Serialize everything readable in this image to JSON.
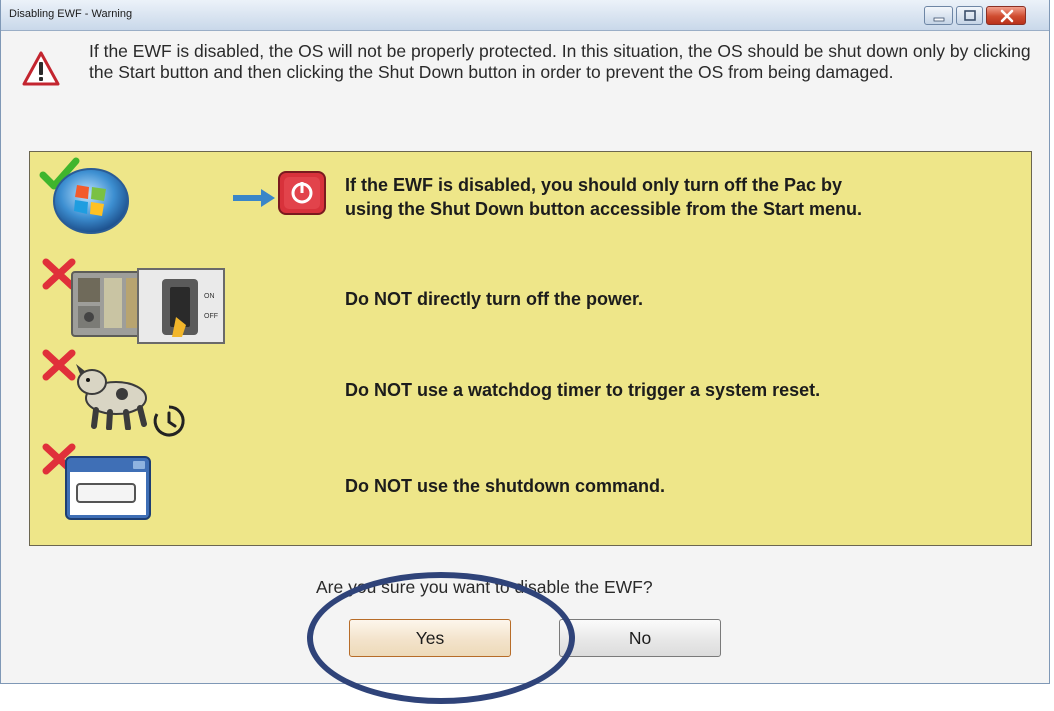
{
  "window": {
    "title": "Disabling EWF - Warning"
  },
  "titlebar": {
    "icons": [
      "minimize-icon",
      "maximize-icon",
      "close-icon"
    ]
  },
  "message": {
    "icon": "warning-triangle-icon",
    "text": "If the EWF is disabled, the OS will not be properly protected. In this situation, the OS should be shut down only by clicking the Start button and then clicking the Shut Down button in order to prevent the OS from being damaged."
  },
  "rows": [
    {
      "text1": "If the EWF is disabled, you should only turn off the Pac by",
      "text2": "using the Shut Down button accessible from the Start menu.",
      "status": "allowed",
      "icons": [
        "checkmark-icon",
        "start-orb-icon",
        "arrow-right-icon",
        "shutdown-button-icon"
      ]
    },
    {
      "text": "Do NOT directly turn off the power.",
      "status": "forbidden",
      "icons": [
        "x-mark-icon",
        "device-icon",
        "power-switch-icon"
      ],
      "switch_on": "ON",
      "switch_off": "OFF"
    },
    {
      "text": "Do NOT use a watchdog timer to trigger a system reset.",
      "status": "forbidden",
      "icons": [
        "x-mark-icon",
        "watchdog-icon",
        "timer-icon"
      ]
    },
    {
      "text": "Do NOT use the shutdown command.",
      "status": "forbidden",
      "icons": [
        "x-mark-icon",
        "command-window-icon"
      ]
    }
  ],
  "question": "Are you sure you want to disable the EWF?",
  "buttons": {
    "yes": "Yes",
    "no": "No"
  },
  "colors": {
    "panel": "#eee689",
    "highlight_circle": "#2f4379",
    "forbidden": "#e0303a",
    "allowed": "#3fb52d"
  }
}
